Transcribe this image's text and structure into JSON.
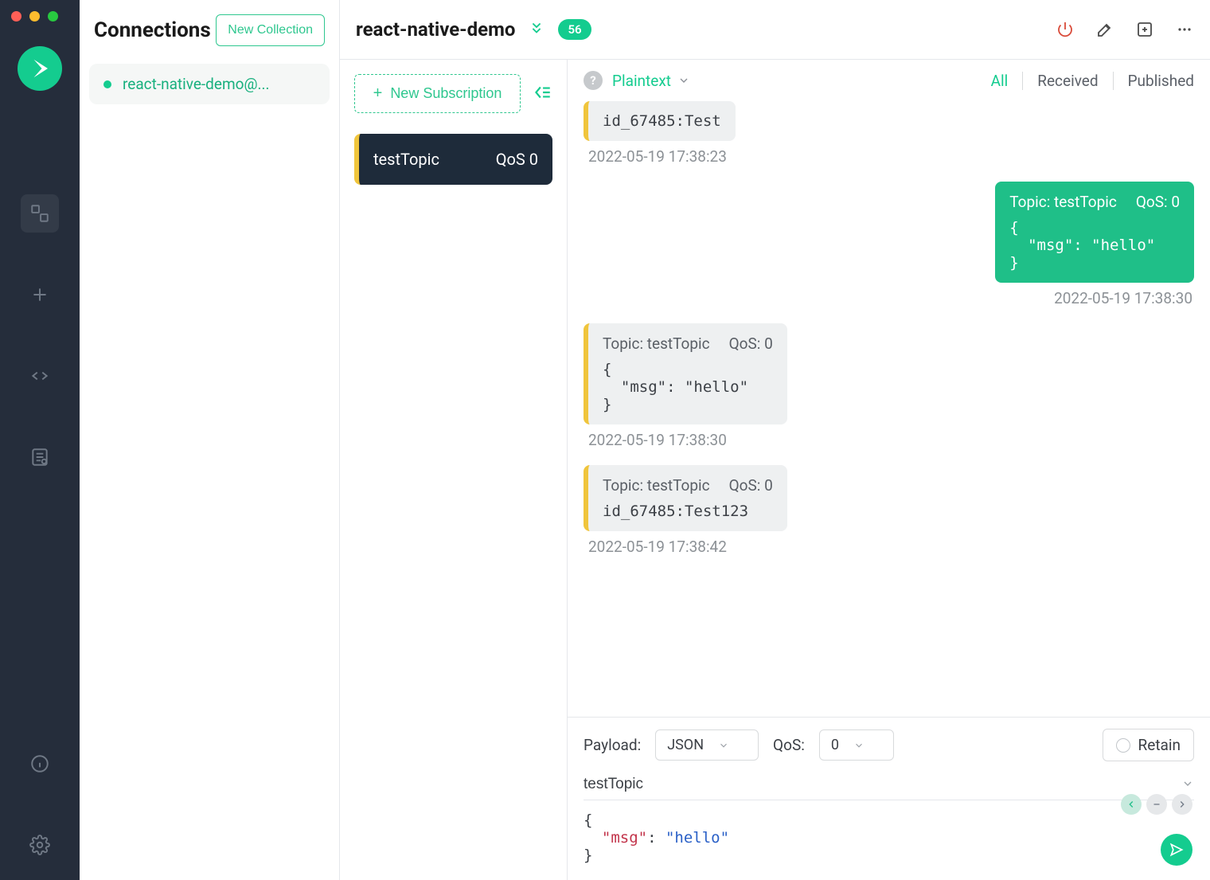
{
  "sidebar": {
    "title": "Connections",
    "new_collection": "New Collection",
    "items": [
      {
        "name": "react-native-demo@...",
        "status": "connected"
      }
    ]
  },
  "header": {
    "title": "react-native-demo",
    "badge": "56"
  },
  "subscriptions": {
    "new_sub": "New Subscription",
    "topics": [
      {
        "name": "testTopic",
        "qos": "QoS 0"
      }
    ]
  },
  "messages_toolbar": {
    "help": "?",
    "format": "Plaintext",
    "tabs": [
      "All",
      "Received",
      "Published"
    ],
    "active_tab": "All"
  },
  "messages": [
    {
      "dir": "rx",
      "body": "id_67485:Test",
      "ts": "2022-05-19 17:38:23",
      "show_meta": false
    },
    {
      "dir": "tx",
      "topic": "Topic: testTopic",
      "qos": "QoS: 0",
      "body": "{\n  \"msg\": \"hello\"\n}",
      "ts": "2022-05-19 17:38:30",
      "show_meta": true
    },
    {
      "dir": "rx",
      "topic": "Topic: testTopic",
      "qos": "QoS: 0",
      "body": "{\n  \"msg\": \"hello\"\n}",
      "ts": "2022-05-19 17:38:30",
      "show_meta": true
    },
    {
      "dir": "rx",
      "topic": "Topic: testTopic",
      "qos": "QoS: 0",
      "body": "id_67485:Test123",
      "ts": "2022-05-19 17:38:42",
      "show_meta": true
    }
  ],
  "composer": {
    "payload_label": "Payload:",
    "payload_value": "JSON",
    "qos_label": "QoS:",
    "qos_value": "0",
    "retain_label": "Retain",
    "topic_value": "testTopic",
    "body_key": "\"msg\"",
    "body_val": "\"hello\""
  }
}
